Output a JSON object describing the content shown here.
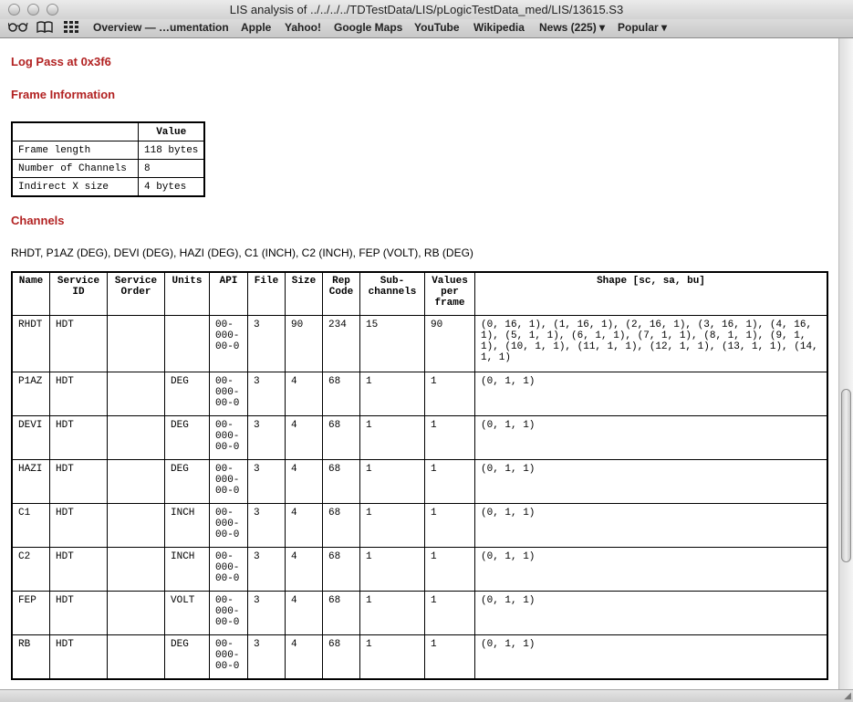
{
  "window": {
    "title": "LIS analysis of ../../../../TDTestData/LIS/pLogicTestData_med/LIS/13615.S3"
  },
  "bookmarks": {
    "icons": [
      "reading-glasses-icon",
      "book-icon",
      "grid-icon"
    ],
    "items": [
      {
        "label": "Overview — …umentation"
      },
      {
        "label": "Apple"
      },
      {
        "label": "Yahoo!"
      },
      {
        "label": "Google Maps"
      },
      {
        "label": "YouTube"
      },
      {
        "label": "Wikipedia"
      },
      {
        "label": "News (225) ▾"
      },
      {
        "label": "Popular ▾"
      }
    ]
  },
  "page": {
    "log_pass_heading": "Log Pass at 0x3f6",
    "frame_heading": "Frame Information",
    "channels_heading": "Channels",
    "channels_list": "RHDT, P1AZ (DEG), DEVI (DEG), HAZI (DEG), C1 (INCH), C2 (INCH), FEP (VOLT), RB (DEG)",
    "accent_color": "#b22222"
  },
  "frame_table": {
    "header": [
      "",
      "Value"
    ],
    "rows": [
      {
        "label": "Frame length",
        "value": "118 bytes"
      },
      {
        "label": "Number of Channels",
        "value": "8"
      },
      {
        "label": "Indirect X size",
        "value": "4 bytes"
      }
    ]
  },
  "channel_table": {
    "headers": [
      "Name",
      "Service ID",
      "Service Order",
      "Units",
      "API",
      "File",
      "Size",
      "Rep Code",
      "Sub-channels",
      "Values per frame",
      "Shape [sc, sa, bu]"
    ],
    "rows": [
      {
        "name": "RHDT",
        "service_id": "HDT",
        "service_order": "",
        "units": "",
        "api": "00-000-00-0",
        "file": "3",
        "size": "90",
        "rep_code": "234",
        "sub_channels": "15",
        "values_per_frame": "90",
        "shape": "(0, 16, 1), (1, 16, 1), (2, 16, 1), (3, 16, 1), (4, 16, 1), (5, 1, 1), (6, 1, 1), (7, 1, 1), (8, 1, 1), (9, 1, 1), (10, 1, 1), (11, 1, 1), (12, 1, 1), (13, 1, 1), (14, 1, 1)"
      },
      {
        "name": "P1AZ",
        "service_id": "HDT",
        "service_order": "",
        "units": "DEG",
        "api": "00-000-00-0",
        "file": "3",
        "size": "4",
        "rep_code": "68",
        "sub_channels": "1",
        "values_per_frame": "1",
        "shape": "(0, 1, 1)"
      },
      {
        "name": "DEVI",
        "service_id": "HDT",
        "service_order": "",
        "units": "DEG",
        "api": "00-000-00-0",
        "file": "3",
        "size": "4",
        "rep_code": "68",
        "sub_channels": "1",
        "values_per_frame": "1",
        "shape": "(0, 1, 1)"
      },
      {
        "name": "HAZI",
        "service_id": "HDT",
        "service_order": "",
        "units": "DEG",
        "api": "00-000-00-0",
        "file": "3",
        "size": "4",
        "rep_code": "68",
        "sub_channels": "1",
        "values_per_frame": "1",
        "shape": "(0, 1, 1)"
      },
      {
        "name": "C1",
        "service_id": "HDT",
        "service_order": "",
        "units": "INCH",
        "api": "00-000-00-0",
        "file": "3",
        "size": "4",
        "rep_code": "68",
        "sub_channels": "1",
        "values_per_frame": "1",
        "shape": "(0, 1, 1)"
      },
      {
        "name": "C2",
        "service_id": "HDT",
        "service_order": "",
        "units": "INCH",
        "api": "00-000-00-0",
        "file": "3",
        "size": "4",
        "rep_code": "68",
        "sub_channels": "1",
        "values_per_frame": "1",
        "shape": "(0, 1, 1)"
      },
      {
        "name": "FEP",
        "service_id": "HDT",
        "service_order": "",
        "units": "VOLT",
        "api": "00-000-00-0",
        "file": "3",
        "size": "4",
        "rep_code": "68",
        "sub_channels": "1",
        "values_per_frame": "1",
        "shape": "(0, 1, 1)"
      },
      {
        "name": "RB",
        "service_id": "HDT",
        "service_order": "",
        "units": "DEG",
        "api": "00-000-00-0",
        "file": "3",
        "size": "4",
        "rep_code": "68",
        "sub_channels": "1",
        "values_per_frame": "1",
        "shape": "(0, 1, 1)"
      }
    ]
  }
}
